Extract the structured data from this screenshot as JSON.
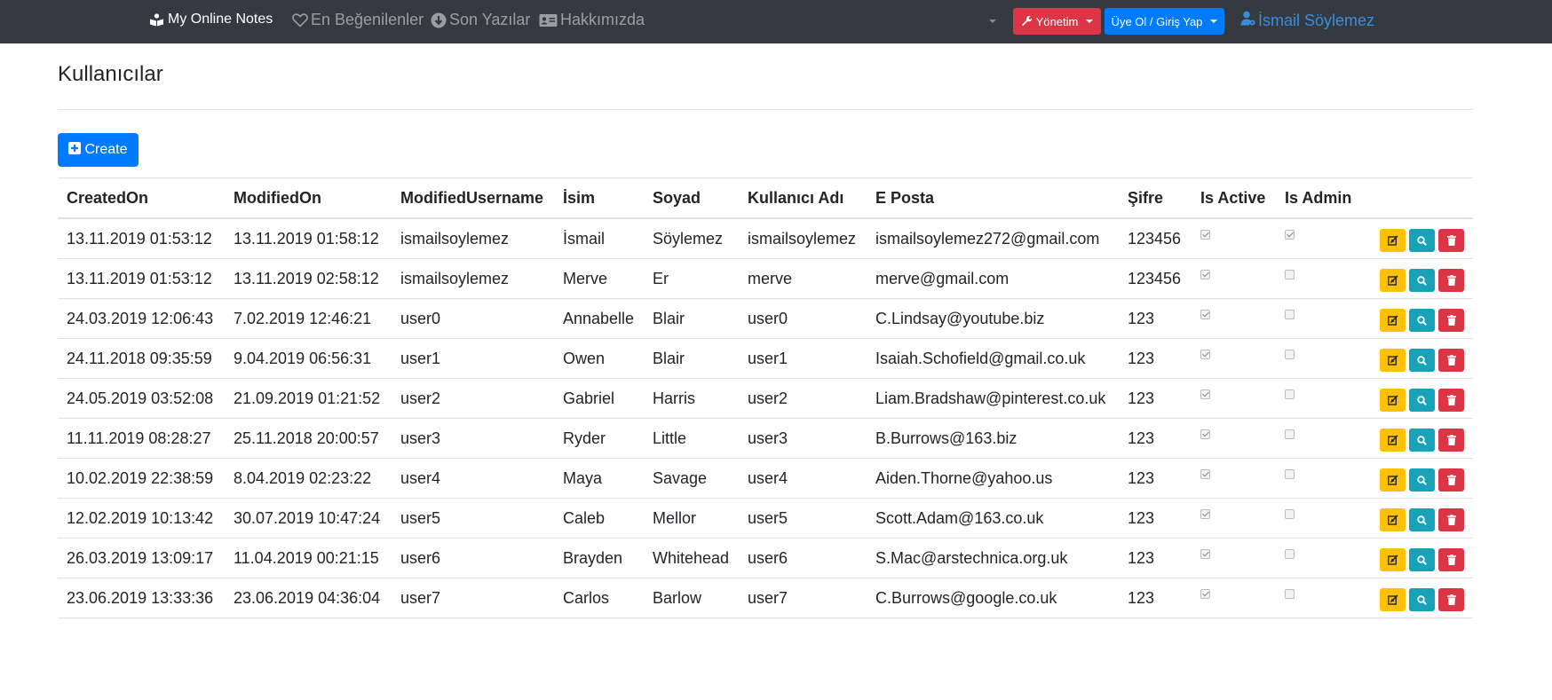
{
  "navbar": {
    "brand": "My Online Notes",
    "links": [
      {
        "label": "En Beğenilenler",
        "icon": "heart-icon"
      },
      {
        "label": "Son Yazılar",
        "icon": "arrow-circle-down-icon"
      },
      {
        "label": "Hakkımızda",
        "icon": "id-card-icon"
      }
    ],
    "admin_label": "Yönetim",
    "auth_label": "Üye Ol / Giriş Yap",
    "user_label": "İsmail Söylemez"
  },
  "page": {
    "title": "Kullanıcılar",
    "create_label": "Create"
  },
  "colors": {
    "navbar_bg": "#343a40",
    "primary": "#007bff",
    "danger": "#dc3545",
    "warning": "#ffc107",
    "info": "#17a2b8"
  },
  "table": {
    "headers": [
      "CreatedOn",
      "ModifiedOn",
      "ModifiedUsername",
      "İsim",
      "Soyad",
      "Kullanıcı Adı",
      "E Posta",
      "Şifre",
      "Is Active",
      "Is Admin",
      ""
    ],
    "rows": [
      {
        "created": "13.11.2019 01:53:12",
        "modified": "13.11.2019 01:58:12",
        "modified_by": "ismailsoylemez",
        "name": "İsmail",
        "surname": "Söylemez",
        "username": "ismailsoylemez",
        "email": "ismailsoylemez272@gmail.com",
        "password": "123456",
        "is_active": true,
        "is_admin": true
      },
      {
        "created": "13.11.2019 01:53:12",
        "modified": "13.11.2019 02:58:12",
        "modified_by": "ismailsoylemez",
        "name": "Merve",
        "surname": "Er",
        "username": "merve",
        "email": "merve@gmail.com",
        "password": "123456",
        "is_active": true,
        "is_admin": false
      },
      {
        "created": "24.03.2019 12:06:43",
        "modified": "7.02.2019 12:46:21",
        "modified_by": "user0",
        "name": "Annabelle",
        "surname": "Blair",
        "username": "user0",
        "email": "C.Lindsay@youtube.biz",
        "password": "123",
        "is_active": true,
        "is_admin": false
      },
      {
        "created": "24.11.2018 09:35:59",
        "modified": "9.04.2019 06:56:31",
        "modified_by": "user1",
        "name": "Owen",
        "surname": "Blair",
        "username": "user1",
        "email": "Isaiah.Schofield@gmail.co.uk",
        "password": "123",
        "is_active": true,
        "is_admin": false
      },
      {
        "created": "24.05.2019 03:52:08",
        "modified": "21.09.2019 01:21:52",
        "modified_by": "user2",
        "name": "Gabriel",
        "surname": "Harris",
        "username": "user2",
        "email": "Liam.Bradshaw@pinterest.co.uk",
        "password": "123",
        "is_active": true,
        "is_admin": false
      },
      {
        "created": "11.11.2019 08:28:27",
        "modified": "25.11.2018 20:00:57",
        "modified_by": "user3",
        "name": "Ryder",
        "surname": "Little",
        "username": "user3",
        "email": "B.Burrows@163.biz",
        "password": "123",
        "is_active": true,
        "is_admin": false
      },
      {
        "created": "10.02.2019 22:38:59",
        "modified": "8.04.2019 02:23:22",
        "modified_by": "user4",
        "name": "Maya",
        "surname": "Savage",
        "username": "user4",
        "email": "Aiden.Thorne@yahoo.us",
        "password": "123",
        "is_active": true,
        "is_admin": false
      },
      {
        "created": "12.02.2019 10:13:42",
        "modified": "30.07.2019 10:47:24",
        "modified_by": "user5",
        "name": "Caleb",
        "surname": "Mellor",
        "username": "user5",
        "email": "Scott.Adam@163.co.uk",
        "password": "123",
        "is_active": true,
        "is_admin": false
      },
      {
        "created": "26.03.2019 13:09:17",
        "modified": "11.04.2019 00:21:15",
        "modified_by": "user6",
        "name": "Brayden",
        "surname": "Whitehead",
        "username": "user6",
        "email": "S.Mac@arstechnica.org.uk",
        "password": "123",
        "is_active": true,
        "is_admin": false
      },
      {
        "created": "23.06.2019 13:33:36",
        "modified": "23.06.2019 04:36:04",
        "modified_by": "user7",
        "name": "Carlos",
        "surname": "Barlow",
        "username": "user7",
        "email": "C.Burrows@google.co.uk",
        "password": "123",
        "is_active": true,
        "is_admin": false
      }
    ]
  }
}
